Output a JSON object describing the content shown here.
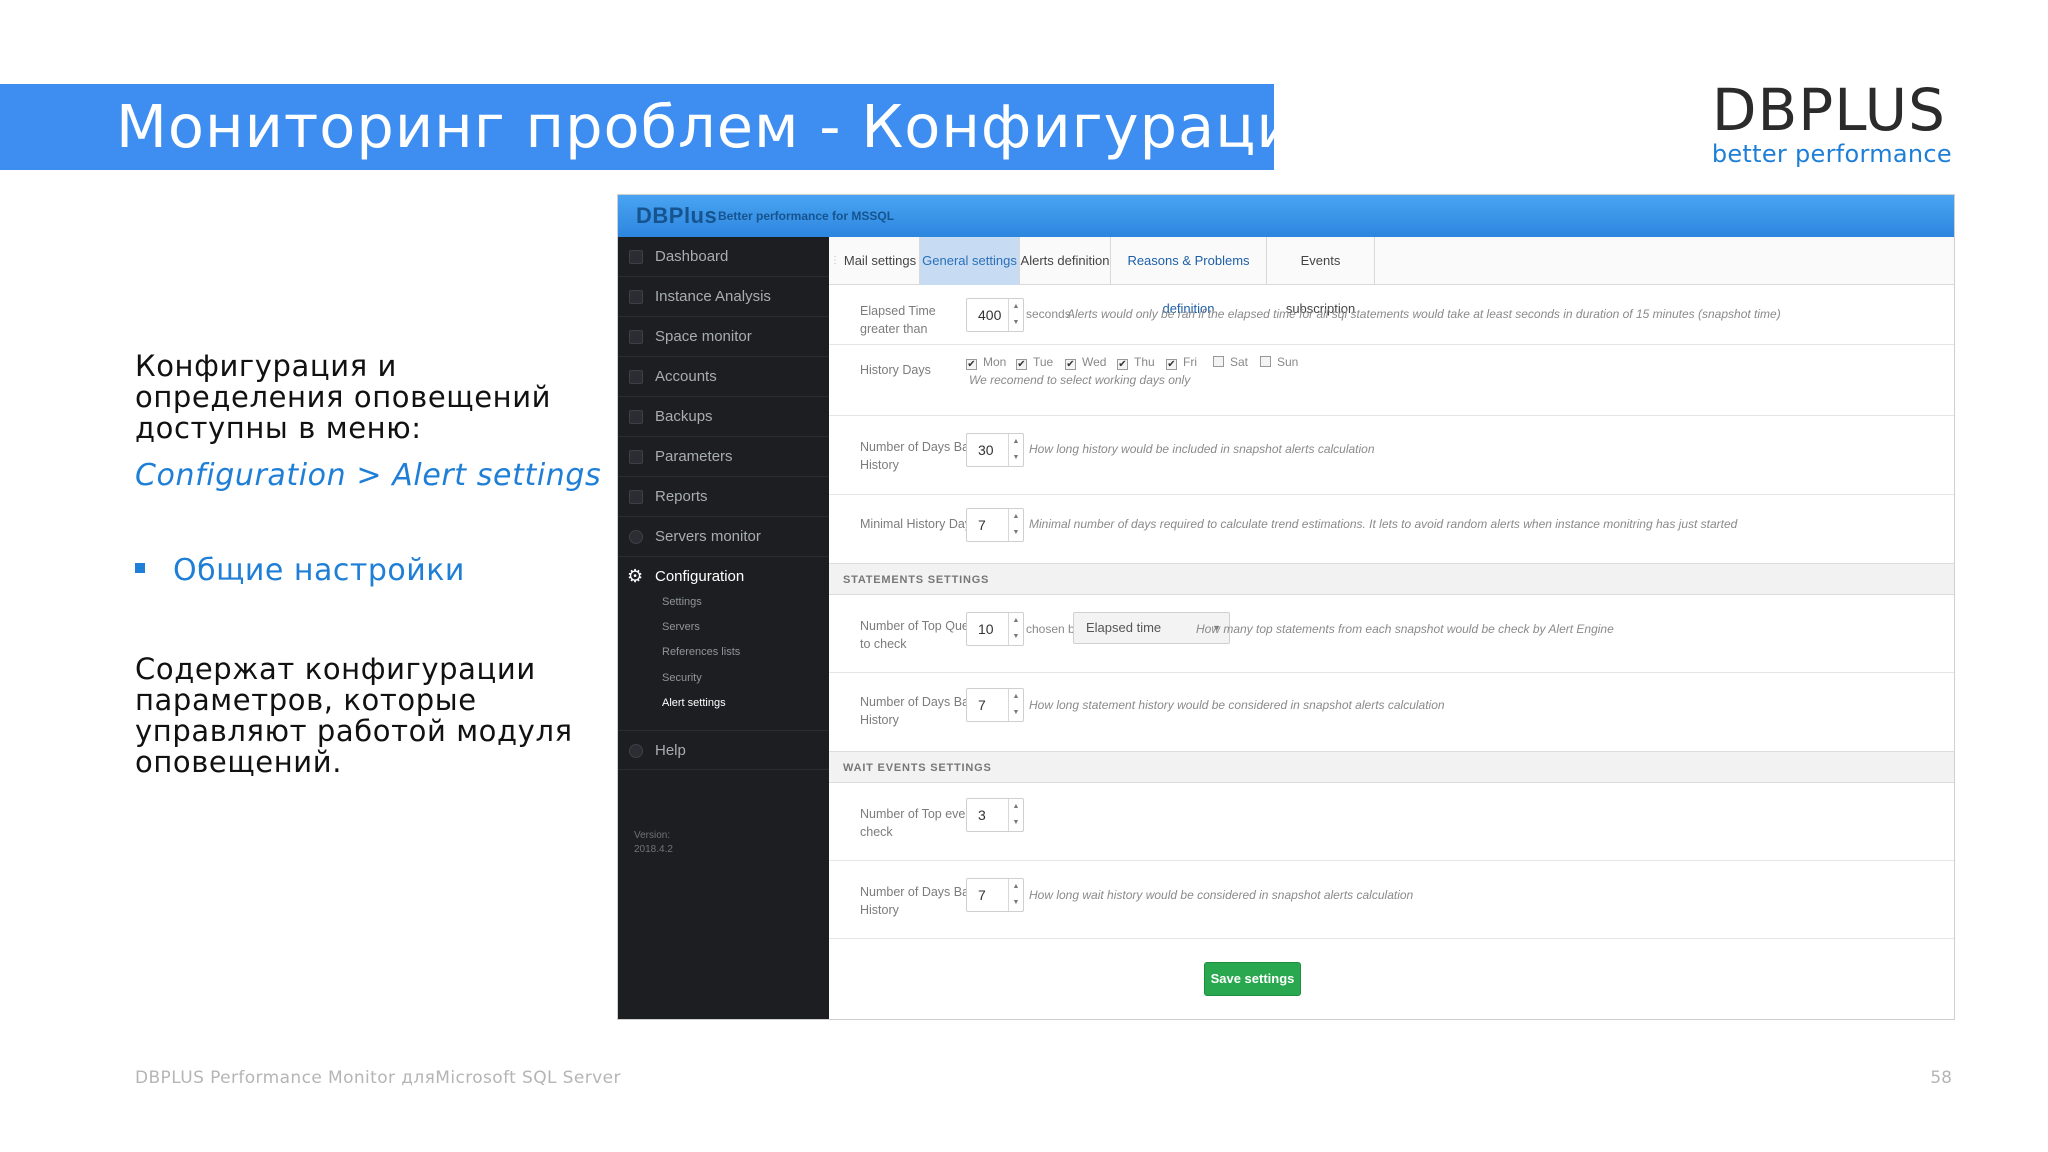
{
  "slide": {
    "title": "Мониторинг проблем - Конфигурация",
    "logo_main": "DBPLUS",
    "logo_sub": "better performance",
    "intro": "Конфигурация и определения оповещений доступны в меню:",
    "menu_path": "Configuration > Alert settings",
    "bullet": "Общие настройки",
    "description": "Содержат конфигурации параметров, которые управляют работой модуля оповещений.",
    "footer": "DBPLUS Performance Monitor дляMicrosoft SQL Server",
    "page_number": "58"
  },
  "app": {
    "brand": "DBPlus",
    "brand_sub": "Better performance   for MSSQL",
    "sidebar": {
      "items": [
        "Dashboard",
        "Instance Analysis",
        "Space monitor",
        "Accounts",
        "Backups",
        "Parameters",
        "Reports",
        "Servers monitor",
        "Configuration",
        "Help"
      ],
      "sub_items": [
        "Settings",
        "Servers",
        "References lists",
        "Security",
        "Alert settings"
      ],
      "version_label": "Version:",
      "version": "2018.4.2"
    },
    "tabs": [
      "Mail settings",
      "General settings",
      "Alerts definition",
      "Reasons & Problems definition",
      "Events subscription"
    ],
    "general": {
      "elapsed": {
        "label": "Elapsed Time greater than",
        "value": "400",
        "unit": "seconds",
        "hint": "Alerts would only be ran if the elapsed time for all sql statements would take at least seconds in duration of 15 minutes (snapshot time)"
      },
      "history_days": {
        "label": "History Days",
        "days": [
          {
            "name": "Mon",
            "checked": true
          },
          {
            "name": "Tue",
            "checked": true
          },
          {
            "name": "Wed",
            "checked": true
          },
          {
            "name": "Thu",
            "checked": true
          },
          {
            "name": "Fri",
            "checked": true
          },
          {
            "name": "Sat",
            "checked": false
          },
          {
            "name": "Sun",
            "checked": false
          }
        ],
        "hint": "We recomend to select working days only"
      },
      "days_back": {
        "label": "Number of Days Back in History",
        "value": "30",
        "hint": "How long history would be included in snapshot alerts calculation"
      },
      "min_history": {
        "label": "Minimal History Days",
        "value": "7",
        "hint": "Minimal number of days required to calculate trend estimations. It lets to avoid random alerts when instance monitring has just started"
      }
    },
    "statements": {
      "header": "STATEMENTS SETTINGS",
      "top_queries": {
        "label": "Number of Top Queries to check",
        "value": "10",
        "chosen_by": "chosen by",
        "select": "Elapsed time",
        "hint": "How many top statements from each snapshot would be check by Alert Engine"
      },
      "days_back": {
        "label": "Number of Days Back in History",
        "value": "7",
        "hint": "How long statement history would be considered in snapshot alerts calculation"
      }
    },
    "wait_events": {
      "header": "WAIT EVENTS SETTINGS",
      "top_events": {
        "label": "Number of Top events to check",
        "value": "3"
      },
      "days_back": {
        "label": "Number of Days Back in History",
        "value": "7",
        "hint": "How long wait history would be considered in snapshot alerts calculation"
      }
    },
    "save_label": "Save settings"
  }
}
